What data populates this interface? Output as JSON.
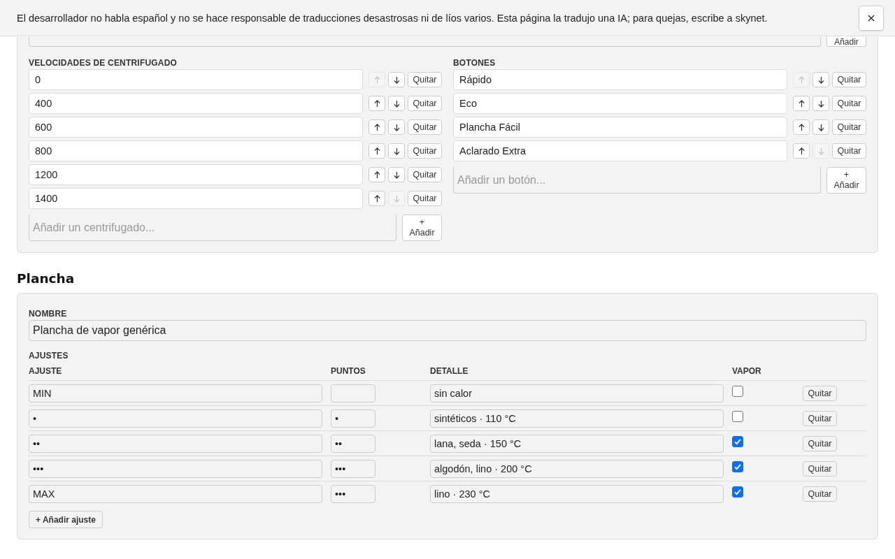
{
  "banner": {
    "message": "El desarrollador no habla español y no se hace responsable de traducciones desastrosas ni de líos varios. Esta página la tradujo una IA; para quejas, escribe a skynet."
  },
  "programs_add": {
    "button": "Añadir"
  },
  "spin_speeds": {
    "label": "VELOCIDADES DE CENTRIFUGADO",
    "items": [
      {
        "value": "0",
        "up_disabled": true,
        "down_disabled": false,
        "remove": "Quitar"
      },
      {
        "value": "400",
        "up_disabled": false,
        "down_disabled": false,
        "remove": "Quitar"
      },
      {
        "value": "600",
        "up_disabled": false,
        "down_disabled": false,
        "remove": "Quitar"
      },
      {
        "value": "800",
        "up_disabled": false,
        "down_disabled": false,
        "remove": "Quitar"
      },
      {
        "value": "1200",
        "up_disabled": false,
        "down_disabled": false,
        "remove": "Quitar"
      },
      {
        "value": "1400",
        "up_disabled": false,
        "down_disabled": true,
        "remove": "Quitar"
      }
    ],
    "add": {
      "placeholder": "Añadir un centrifugado...",
      "button_plus": "+",
      "button": "Añadir"
    }
  },
  "buttons_list": {
    "label": "BOTONES",
    "items": [
      {
        "value": "Rápido",
        "up_disabled": true,
        "down_disabled": false,
        "remove": "Quitar"
      },
      {
        "value": "Eco",
        "up_disabled": false,
        "down_disabled": false,
        "remove": "Quitar"
      },
      {
        "value": "Plancha Fácil",
        "up_disabled": false,
        "down_disabled": false,
        "remove": "Quitar"
      },
      {
        "value": "Aclarado Extra",
        "up_disabled": false,
        "down_disabled": true,
        "remove": "Quitar"
      }
    ],
    "add": {
      "placeholder": "Añadir un botón...",
      "button_plus": "+",
      "button": "Añadir"
    }
  },
  "iron": {
    "title": "Plancha",
    "name_label": "NOMBRE",
    "name": "Plancha de vapor genérica",
    "settings_label": "AJUSTES",
    "columns": [
      "AJUSTE",
      "PUNTOS",
      "DETALLE",
      "VAPOR"
    ],
    "rows": [
      {
        "setting": "MIN",
        "dots": "",
        "detail": "sin calor",
        "steam": false,
        "remove": "Quitar"
      },
      {
        "setting": "•",
        "dots": "•",
        "detail": "sintéticos · 110 °C",
        "steam": false,
        "remove": "Quitar"
      },
      {
        "setting": "••",
        "dots": "••",
        "detail": "lana, seda · 150 °C",
        "steam": true,
        "remove": "Quitar"
      },
      {
        "setting": "•••",
        "dots": "•••",
        "detail": "algodón, lino · 200 °C",
        "steam": true,
        "remove": "Quitar"
      },
      {
        "setting": "MAX",
        "dots": "•••",
        "detail": "lino · 230 °C",
        "steam": true,
        "remove": "Quitar"
      }
    ],
    "add_button": "+ Añadir ajuste"
  }
}
